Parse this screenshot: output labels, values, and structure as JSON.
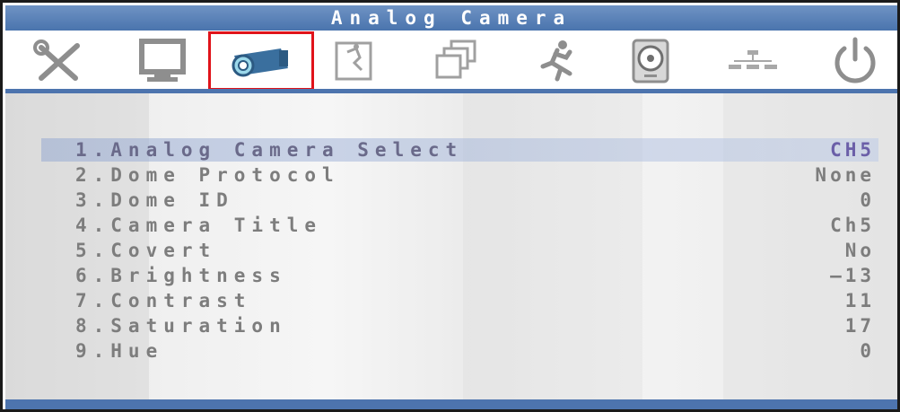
{
  "window": {
    "title": "Analog Camera"
  },
  "toolbar": {
    "icons": [
      {
        "name": "tools-icon",
        "selected": false
      },
      {
        "name": "monitor-icon",
        "selected": false
      },
      {
        "name": "camera-icon",
        "selected": true
      },
      {
        "name": "motion-alarm-icon",
        "selected": false
      },
      {
        "name": "multi-window-icon",
        "selected": false
      },
      {
        "name": "running-person-icon",
        "selected": false
      },
      {
        "name": "hard-disk-icon",
        "selected": false
      },
      {
        "name": "network-icon",
        "selected": false
      },
      {
        "name": "power-icon",
        "selected": false
      }
    ],
    "selected_color": "#e0131a"
  },
  "menu": {
    "items": [
      {
        "label": "1.Analog Camera Select",
        "value": "CH5"
      },
      {
        "label": "2.Dome Protocol",
        "value": "None"
      },
      {
        "label": "3.Dome ID",
        "value": "0"
      },
      {
        "label": "4.Camera Title",
        "value": "Ch5"
      },
      {
        "label": "5.Covert",
        "value": "No"
      },
      {
        "label": "6.Brightness",
        "value": "—13"
      },
      {
        "label": "7.Contrast",
        "value": "11"
      },
      {
        "label": "8.Saturation",
        "value": "17"
      },
      {
        "label": "9.Hue",
        "value": "0"
      }
    ],
    "selected_index": 0
  },
  "colors": {
    "accent": "#4d74ae",
    "text": "#7d7d7d",
    "selected_value": "#6b5fa8"
  }
}
